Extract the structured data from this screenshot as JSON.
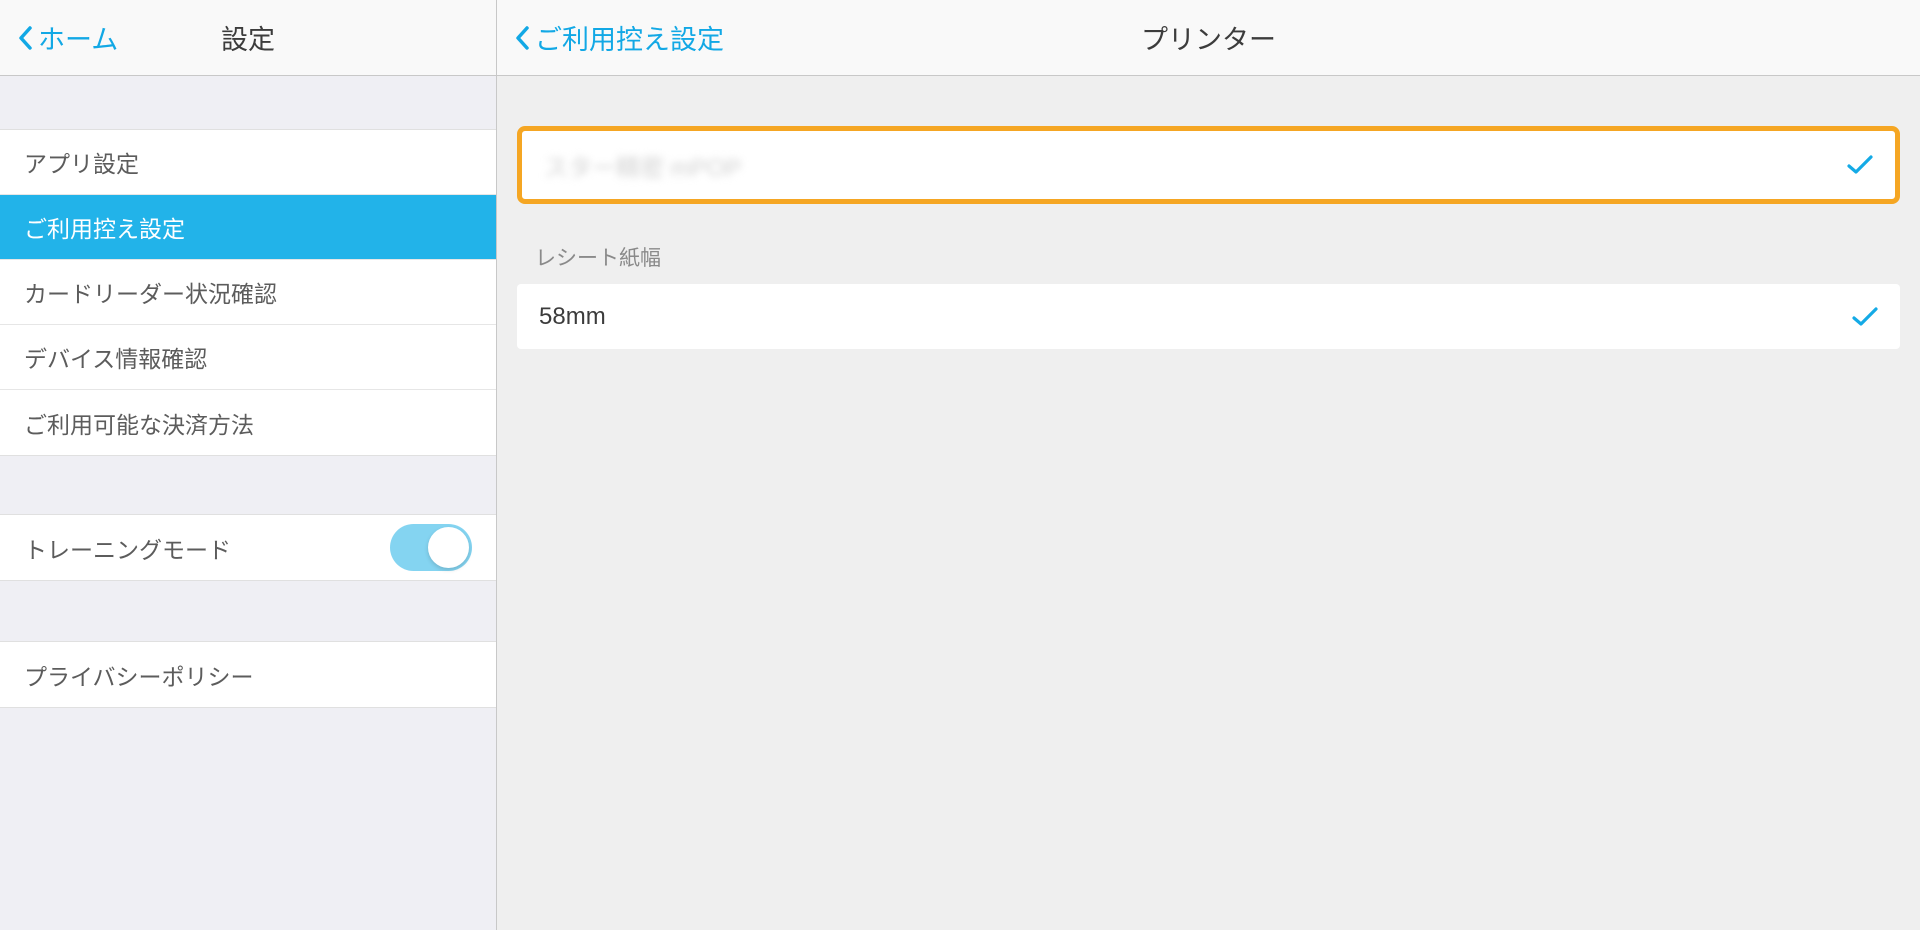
{
  "left": {
    "back_label": "ホーム",
    "title": "設定",
    "items_group1": [
      {
        "label": "アプリ設定",
        "selected": false
      },
      {
        "label": "ご利用控え設定",
        "selected": true
      },
      {
        "label": "カードリーダー状況確認",
        "selected": false
      },
      {
        "label": "デバイス情報確認",
        "selected": false
      },
      {
        "label": "ご利用可能な決済方法",
        "selected": false
      }
    ],
    "training_mode_label": "トレーニングモード",
    "training_mode_on": true,
    "items_group3": [
      {
        "label": "プライバシーポリシー"
      }
    ]
  },
  "right": {
    "back_label": "ご利用控え設定",
    "title": "プリンター",
    "printer_blurred_text": "スター精密 mPOP",
    "printer_selected": true,
    "paper_width_section_label": "レシート紙幅",
    "paper_width_value": "58mm",
    "paper_width_selected": true
  },
  "colors": {
    "accent": "#12a8e5",
    "sel_bg": "#22b3e9",
    "highlight_border": "#f5a623"
  }
}
